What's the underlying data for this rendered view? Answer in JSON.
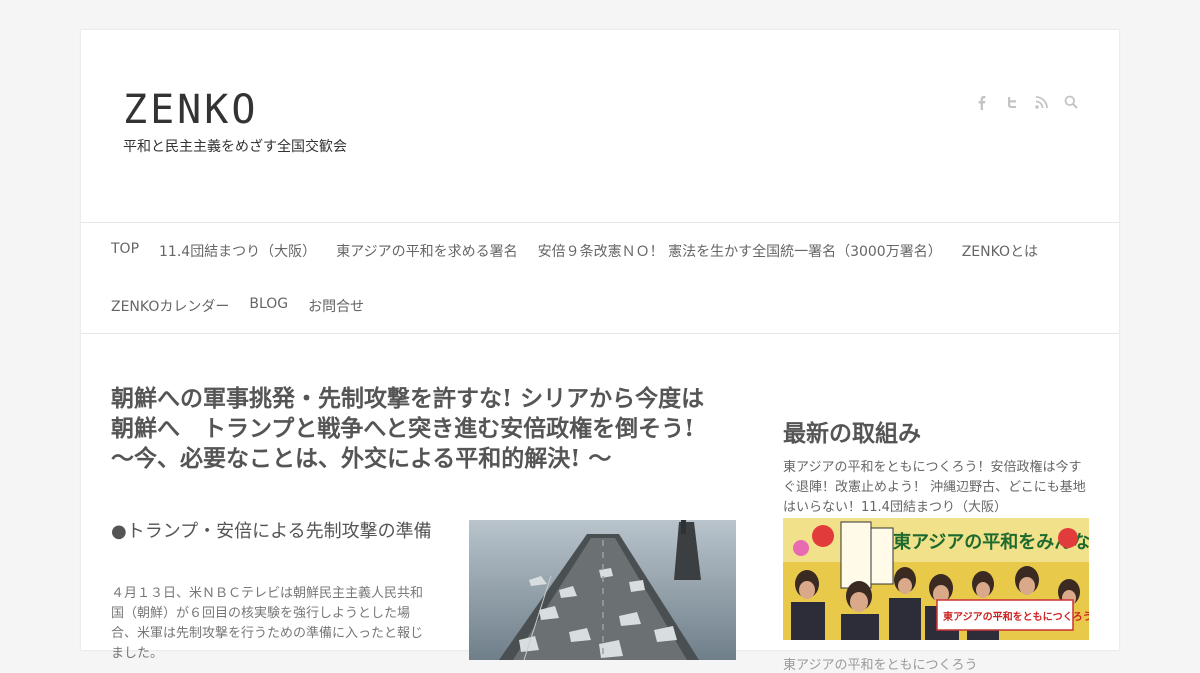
{
  "site": {
    "title": "ZENKO",
    "tagline": "平和と民主主義をめざす全国交歓会"
  },
  "social": [
    "facebook-icon",
    "twitter-icon",
    "rss-icon",
    "search-icon"
  ],
  "nav": {
    "row1": [
      "TOP",
      "11.4団結まつり（大阪）",
      "東アジアの平和を求める署名",
      "安倍９条改憲ＮＯ！ 憲法を生かす全国統一署名（3000万署名）",
      "ZENKOとは"
    ],
    "row2": [
      "ZENKOカレンダー",
      "BLOG",
      "お問合せ"
    ]
  },
  "post": {
    "title_line1": "朝鮮への軍事挑発・先制攻撃を許すな! シリアから今度は",
    "title_line2": "朝鮮へ　トランプと戦争へと突き進む安倍政権を倒そう!",
    "title_line3": "～今、必要なことは、外交による平和的解決! ～",
    "subhead": "●トランプ・安倍による先制攻撃の準備",
    "text": "４月１３日、米ＮＢＣテレビは朝鮮民主主義人民共和国（朝鮮）が６回目の核実験を強行しようとした場合、米軍は先制攻撃を行うための準備に入ったと報じました。"
  },
  "sidebar": {
    "title": "最新の取組み",
    "item_text": "東アジアの平和をともにつくろう！安倍政権は今すぐ退陣！改憲止めよう！ 沖縄辺野古、どこにも基地はいらない！11.4団結まつり（大阪）",
    "banner_text": "東アジアの平和をみんなでつく",
    "sign_text": "東アジアの平和をともにつくろう!",
    "next_text": "東アジアの平和をともにつくろう"
  }
}
